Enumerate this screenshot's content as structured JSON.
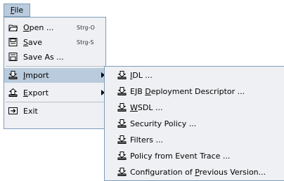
{
  "menubar": {
    "file_pre": "",
    "file_mn": "F",
    "file_post": "ile"
  },
  "file_menu": {
    "open": {
      "pre": "",
      "mn": "O",
      "post": "pen ...",
      "accel": "Strg-O"
    },
    "save": {
      "pre": "",
      "mn": "S",
      "post": "ave",
      "accel": "Strg-S"
    },
    "saveas": {
      "label": "Save As ..."
    },
    "import": {
      "pre": "",
      "mn": "I",
      "post": "mport"
    },
    "export": {
      "pre": "",
      "mn": "E",
      "post": "xport"
    },
    "exit": {
      "label": "Exit"
    }
  },
  "import_menu": {
    "idl": {
      "pre": "",
      "mn": "I",
      "post": "DL ..."
    },
    "ejb": {
      "pre": "EJB ",
      "mn": "D",
      "post": "eployment Descriptor ..."
    },
    "wsdl": {
      "pre": "",
      "mn": "W",
      "post": "SDL ..."
    },
    "security": {
      "label": "Security Policy ..."
    },
    "filters": {
      "label": "Filters ..."
    },
    "policy": {
      "label": "Policy from Event Trace ..."
    },
    "config": {
      "pre": "Configuration of ",
      "mn": "P",
      "post": "revious Version..."
    }
  },
  "colors": {
    "highlight": "#b9cbdc",
    "menu_bg": "#eef0f3",
    "border": "#7f9db9"
  }
}
